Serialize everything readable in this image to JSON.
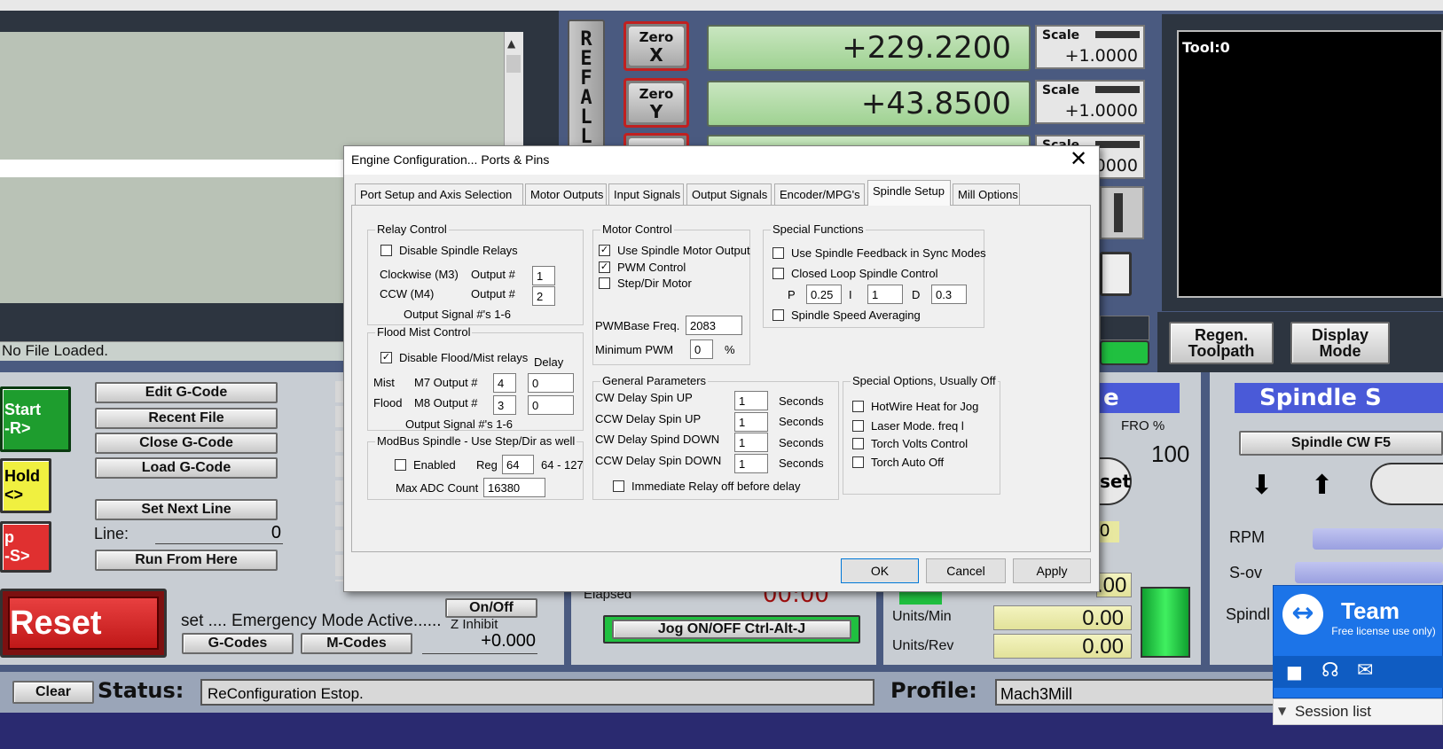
{
  "app": {
    "file_status": "No File Loaded.",
    "tool_display": "Tool:0",
    "ref_all_label": "R E F A L L"
  },
  "axes": [
    {
      "zero_label_top": "Zero",
      "zero_label_axis": "X",
      "dro_value": "+229.2200",
      "scale_label": "Scale",
      "scale_value": "+1.0000"
    },
    {
      "zero_label_top": "Zero",
      "zero_label_axis": "Y",
      "dro_value": "+43.8500",
      "scale_label": "Scale",
      "scale_value": "+1.0000"
    },
    {
      "scale_label": "Scale",
      "scale_value": ".0000"
    }
  ],
  "buttons": {
    "regen_toolpath": "Regen. Toolpath",
    "display_mode": "Display Mode",
    "edit_gcode": "Edit G-Code",
    "recent_file": "Recent File",
    "close_gcode": "Close G-Code",
    "load_gcode": "Load G-Code",
    "set_next_line": "Set Next Line",
    "run_from_here": "Run From Here",
    "cycle_start": "Start\n-R>",
    "feed_hold": "Hold\n<>",
    "stop": "p\n-S>",
    "reset": "Reset",
    "on_off": "On/Off",
    "gcodes": "G-Codes",
    "mcodes": "M-Codes",
    "jog_toggle": "Jog ON/OFF Ctrl-Alt-J",
    "clear": "Clear",
    "spindle_cw": "Spindle CW F5"
  },
  "labels": {
    "line": "Line:",
    "line_value": "0",
    "emergency": "set .... Emergency Mode Active......",
    "z_inhibit": "Z Inhibit",
    "z_inhibit_value": "+0.000",
    "elapsed": "Elapsed",
    "elapsed_value": "00:00",
    "units_min": "Units/Min",
    "units_min_value": "0.00",
    "units_rev": "Units/Rev",
    "units_rev_value": "0.00",
    "fro": "FRO %",
    "fro_value": "100",
    "spindle_panel_title": "Spindle S",
    "rpm": "RPM",
    "sov": "S-ov",
    "spindl": "Spindl",
    "status_title": "Status:",
    "status_text": "ReConfiguration Estop.",
    "profile_title": "Profile:",
    "profile_text": "Mach3Mill",
    "fro_fragment": "e",
    "reset_fragment": "set",
    "partial_value": "0",
    "partial_value2": ".00"
  },
  "teamviewer": {
    "title": "Team",
    "subtitle": "Free license use only)",
    "session_list": "Session list"
  },
  "dialog": {
    "title": "Engine Configuration... Ports & Pins",
    "tabs": [
      "Port Setup and Axis Selection",
      "Motor Outputs",
      "Input Signals",
      "Output Signals",
      "Encoder/MPG's",
      "Spindle Setup",
      "Mill Options"
    ],
    "relay": {
      "title": "Relay Control",
      "disable": "Disable Spindle Relays",
      "cw_label": "Clockwise (M3)",
      "ccw_label": "CCW (M4)",
      "output_label": "Output #",
      "cw_output": "1",
      "ccw_output": "2",
      "note": "Output Signal #'s 1-6"
    },
    "flood": {
      "title": "Flood Mist Control",
      "disable": "Disable Flood/Mist relays",
      "delay": "Delay",
      "mist": "Mist",
      "m7": "M7 Output #",
      "m7_value": "4",
      "m7_delay": "0",
      "flood": "Flood",
      "m8": "M8 Output #",
      "m8_value": "3",
      "m8_delay": "0",
      "note": "Output Signal #'s 1-6"
    },
    "modbus": {
      "title": "ModBus Spindle - Use Step/Dir as well",
      "enabled": "Enabled",
      "reg": "Reg",
      "reg_value": "64",
      "reg_range": "64 - 127",
      "max_adc": "Max ADC Count",
      "max_adc_value": "16380"
    },
    "motor": {
      "title": "Motor Control",
      "use_output": "Use Spindle Motor Output",
      "pwm": "PWM Control",
      "stepdir": "Step/Dir Motor",
      "pwm_base": "PWMBase Freq.",
      "pwm_base_value": "2083",
      "min_pwm": "Minimum PWM",
      "min_pwm_value": "0",
      "percent": "%"
    },
    "special": {
      "title": "Special Functions",
      "feedback": "Use Spindle Feedback in Sync Modes",
      "closed_loop": "Closed Loop Spindle Control",
      "p": "P",
      "p_value": "0.25",
      "i": "I",
      "i_value": "1",
      "d": "D",
      "d_value": "0.3",
      "averaging": "Spindle Speed Averaging"
    },
    "general": {
      "title": "General Parameters",
      "rows": [
        {
          "label": "CW Delay Spin UP",
          "value": "1",
          "unit": "Seconds"
        },
        {
          "label": "CCW Delay Spin UP",
          "value": "1",
          "unit": "Seconds"
        },
        {
          "label": "CW Delay Spind DOWN",
          "value": "1",
          "unit": "Seconds"
        },
        {
          "label": "CCW Delay Spin DOWN",
          "value": "1",
          "unit": "Seconds"
        }
      ],
      "immediate": "Immediate Relay off before delay"
    },
    "options": {
      "title": "Special Options, Usually Off",
      "hotwire": "HotWire Heat for Jog",
      "laser": "Laser Mode. freq l",
      "torch_volts": "Torch Volts Control",
      "torch_auto": "Torch Auto Off"
    },
    "ok": "OK",
    "cancel": "Cancel",
    "apply": "Apply"
  }
}
